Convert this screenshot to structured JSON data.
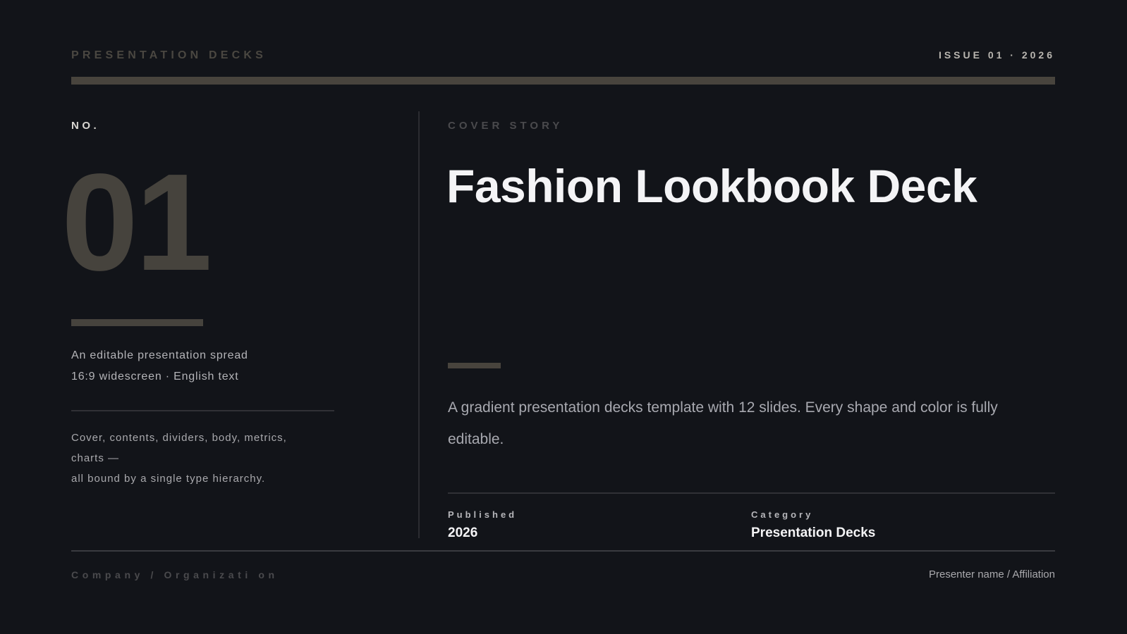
{
  "header": {
    "brand": "PRESENTATION DECKS",
    "issue": "ISSUE 01 · 2026"
  },
  "left": {
    "no_label": "NO.",
    "number": "01",
    "meta_lines": [
      "An editable presentation spread",
      "16:9 widescreen · English text"
    ],
    "description_lines": [
      "Cover, contents, dividers, body, metrics,",
      "charts —",
      "all bound by a single type hierarchy."
    ]
  },
  "right": {
    "kicker": "COVER STORY",
    "title": "Fashion Lookbook Deck",
    "lede": "A gradient presentation decks template with 12 slides. Every shape and color is fully editable.",
    "fields": [
      {
        "label": "Published",
        "value": "2026"
      },
      {
        "label": "Category",
        "value": "Presentation Decks"
      }
    ]
  },
  "footer": {
    "company": "Company / Organizati on",
    "presenter": "Presenter name / Affiliation"
  },
  "colors": {
    "background": "#121419",
    "accent": "#48443d",
    "title": "#f4f4f6",
    "muted": "#a8a9b0"
  }
}
